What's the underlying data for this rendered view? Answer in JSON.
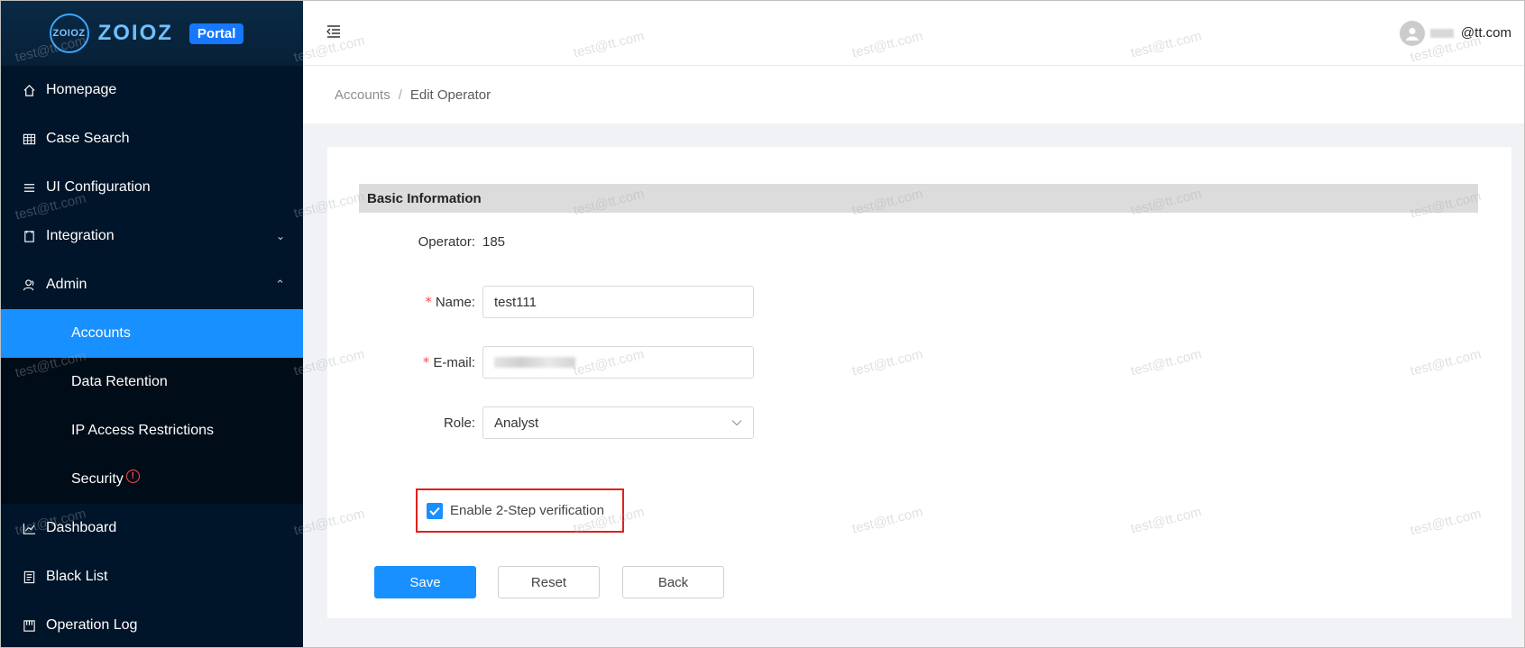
{
  "logo": {
    "mark_text": "ZOIOZ",
    "wordmark": "ZOIOZ",
    "badge": "Portal"
  },
  "sidebar": {
    "items": [
      {
        "label": "Homepage",
        "icon": "home-icon"
      },
      {
        "label": "Case Search",
        "icon": "table-icon"
      },
      {
        "label": "UI Configuration",
        "icon": "list-icon"
      },
      {
        "label": "Integration",
        "icon": "document-icon"
      },
      {
        "label": "Admin",
        "icon": "user-group-icon"
      }
    ],
    "admin_sub": [
      {
        "label": "Accounts",
        "active": true
      },
      {
        "label": "Data Retention"
      },
      {
        "label": "IP Access Restrictions"
      },
      {
        "label": "Security"
      }
    ],
    "items_after": [
      {
        "label": "Dashboard",
        "icon": "line-chart-icon"
      },
      {
        "label": "Black List",
        "icon": "file-list-icon"
      },
      {
        "label": "Operation Log",
        "icon": "calendar-icon"
      }
    ]
  },
  "header": {
    "user_email_suffix": "@tt.com"
  },
  "breadcrumb": {
    "parent": "Accounts",
    "separator": "/",
    "current": "Edit Operator"
  },
  "form": {
    "section_title": "Basic Information",
    "operator_label": "Operator:",
    "operator_value": "185",
    "name_label": "Name:",
    "name_value": "test111",
    "email_label": "E-mail:",
    "role_label": "Role:",
    "role_value": "Analyst",
    "required_mark": "*",
    "two_step_label": "Enable 2-Step verification",
    "two_step_checked": true
  },
  "buttons": {
    "save": "Save",
    "reset": "Reset",
    "back": "Back"
  },
  "watermark": "test@tt.com",
  "colors": {
    "sidebar_bg": "#001529",
    "active_item": "#1890ff",
    "primary": "#1890ff",
    "highlight_border": "#e0201b",
    "required": "#ff4d4f"
  }
}
